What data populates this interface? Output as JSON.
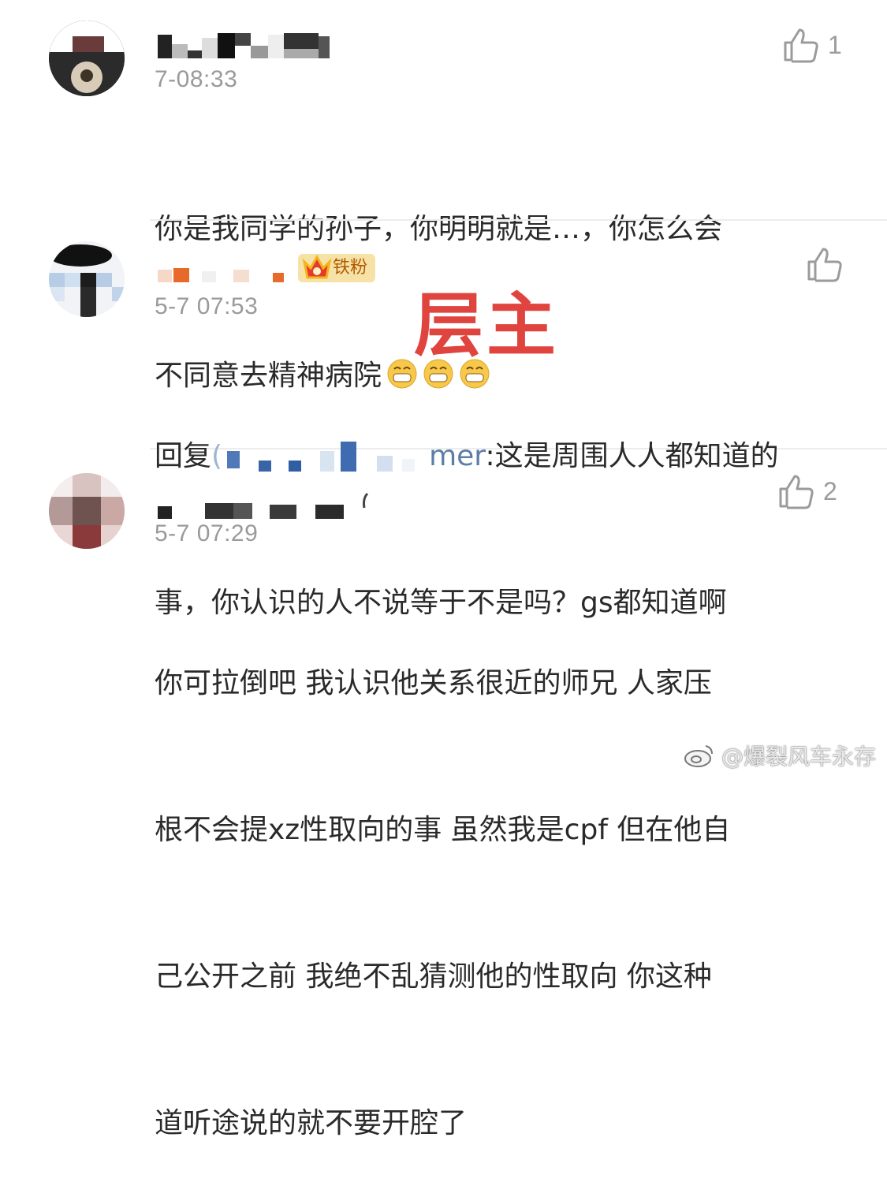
{
  "comments": [
    {
      "time": "7-08:33",
      "text_line1": "你是我同学的孙子，你明明就是…，你怎么会",
      "text_line2": "不同意去精神病院",
      "likes": "1"
    },
    {
      "badge": "铁粉",
      "time": "5-7 07:53",
      "reply_prefix": "回复",
      "mention_tail": "mer",
      "text_line1_rest": ":这是周围人人都知道的",
      "text_line2": "事，你认识的人不说等于不是吗？gs都知道啊",
      "likes": ""
    },
    {
      "time": "5-7 07:29",
      "text_line1": "你可拉倒吧 我认识他关系很近的师兄 人家压",
      "text_line2": "根不会提xz性取向的事 虽然我是cpf 但在他自",
      "text_line3": "己公开之前 我绝不乱猜测他的性取向 你这种",
      "text_line4": "道听途说的就不要开腔了",
      "likes": "2"
    }
  ],
  "overlay_label": "层主",
  "watermark": "@爆裂风车永存",
  "icons": {
    "like": "thumbs-up-icon",
    "emoji": "grinning-face-icon",
    "weibo": "weibo-logo-icon",
    "crown": "crown-icon"
  },
  "colors": {
    "text": "#2a2a2a",
    "meta": "#9a9a9a",
    "mention": "#5b7ea6",
    "overlay": "#e0443f",
    "badge_bg": "#f6e2a6"
  }
}
